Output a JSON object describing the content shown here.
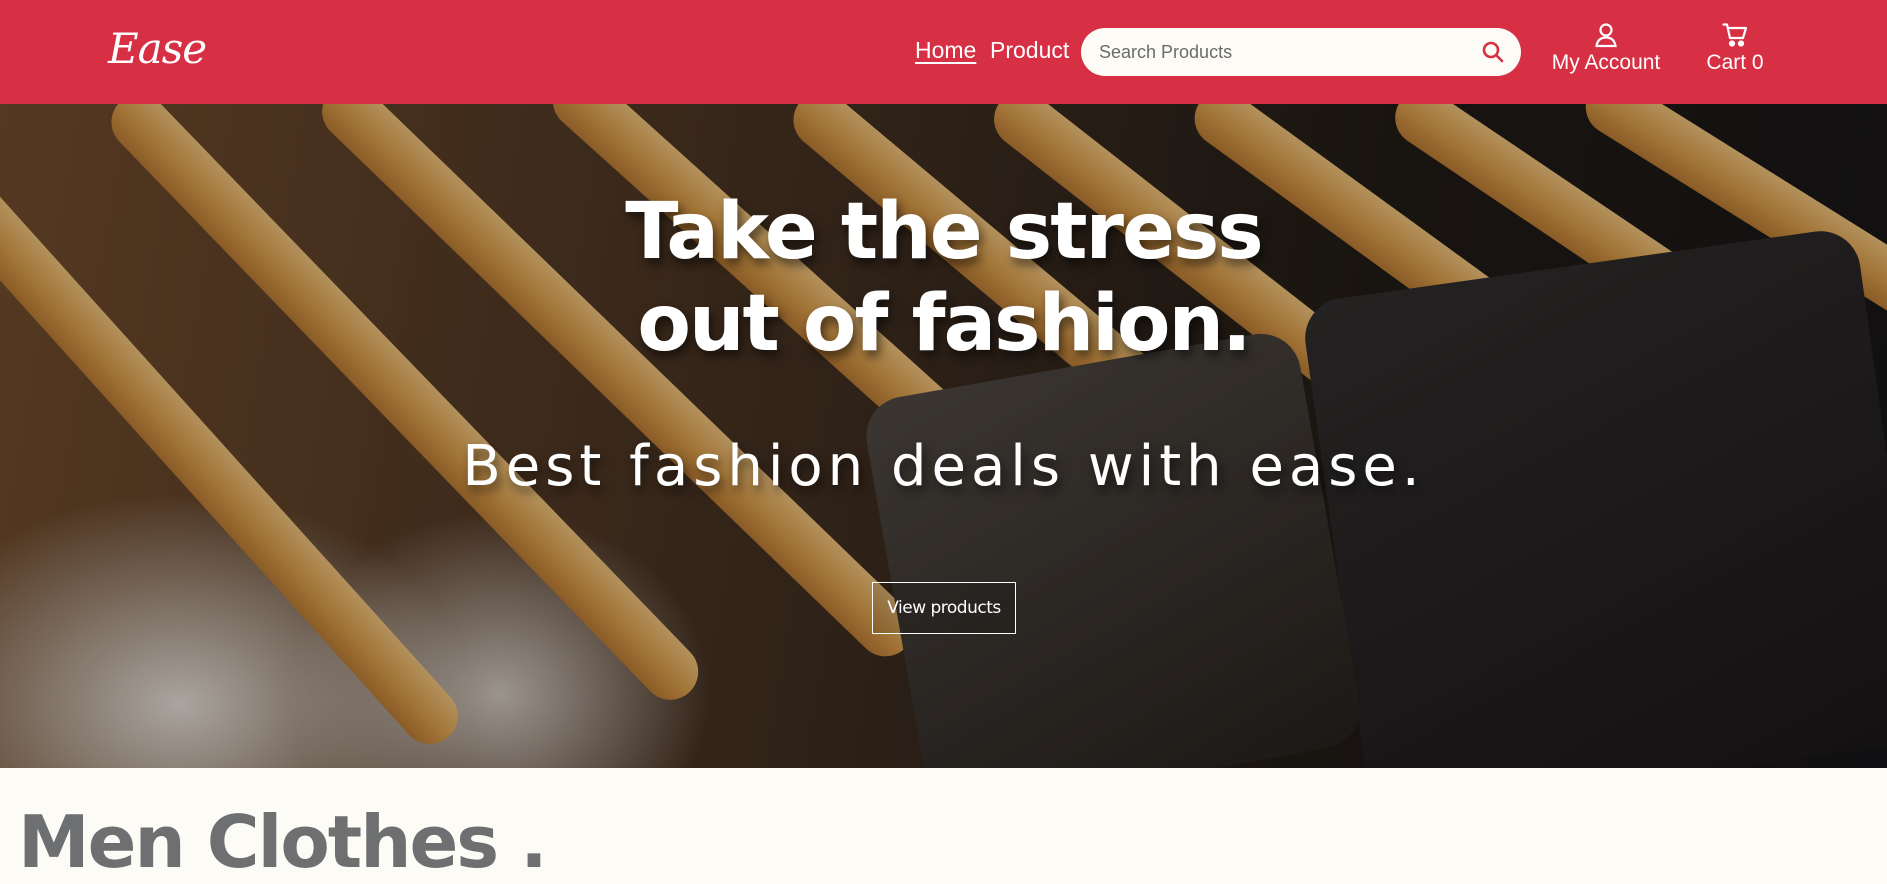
{
  "brand": {
    "logo_text": "Ease"
  },
  "nav": {
    "links": [
      {
        "label": "Home",
        "active": true
      },
      {
        "label": "Product",
        "active": false
      }
    ],
    "search": {
      "placeholder": "Search Products",
      "value": "",
      "icon": "search-icon"
    },
    "account": {
      "label": "My Account",
      "icon": "user-icon"
    },
    "cart": {
      "label": "Cart 0",
      "icon": "cart-icon"
    }
  },
  "hero": {
    "title_line1": "Take the stress",
    "title_line2": "out of fashion.",
    "subtitle": "Best fashion deals with ease.",
    "cta_label": "View products"
  },
  "section": {
    "title": "Men Clothes ."
  },
  "colors": {
    "accent": "#d72f43",
    "page_background": "#fdfbf6",
    "section_title": "#6e6f71"
  }
}
